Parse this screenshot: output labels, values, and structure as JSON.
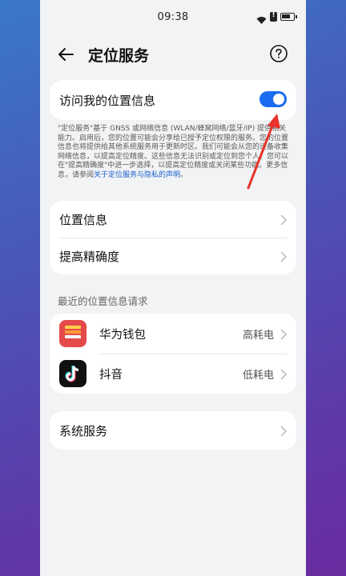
{
  "status_bar": {
    "time": "09:38"
  },
  "header": {
    "title": "定位服务"
  },
  "location_access": {
    "label": "访问我的位置信息",
    "enabled": true
  },
  "description": {
    "text": "\"定位服务\"基于 GNSS 或网络信息 (WLAN/蜂窝网络/蓝牙/IP) 提供相关能力。启用后，您的位置可能会分享给已授予定位权限的服务。您的位置信息也将提供给其他系统服务用于更新时区。我们可能会从您的设备收集网络信息，以提高定位精度。这些信息无法识别或定位到您个人。您可以在\"提高精确度\"中进一步选择，以提高定位精度或关闭某些功能。更多信息，请参阅",
    "link": "关于定位服务与隐私的声明",
    "suffix": "。"
  },
  "settings": {
    "location_info": "位置信息",
    "improve_accuracy": "提高精确度"
  },
  "recent_requests": {
    "header": "最近的位置信息请求",
    "apps": [
      {
        "name": "华为钱包",
        "usage": "高耗电",
        "icon": "huawei-wallet-icon"
      },
      {
        "name": "抖音",
        "usage": "低耗电",
        "icon": "douyin-icon"
      }
    ]
  },
  "system_services": {
    "label": "系统服务"
  },
  "colors": {
    "accent": "#1a6cf0",
    "arrow": "#e8322b",
    "card": "#ffffff",
    "page": "#f1f3f5"
  }
}
